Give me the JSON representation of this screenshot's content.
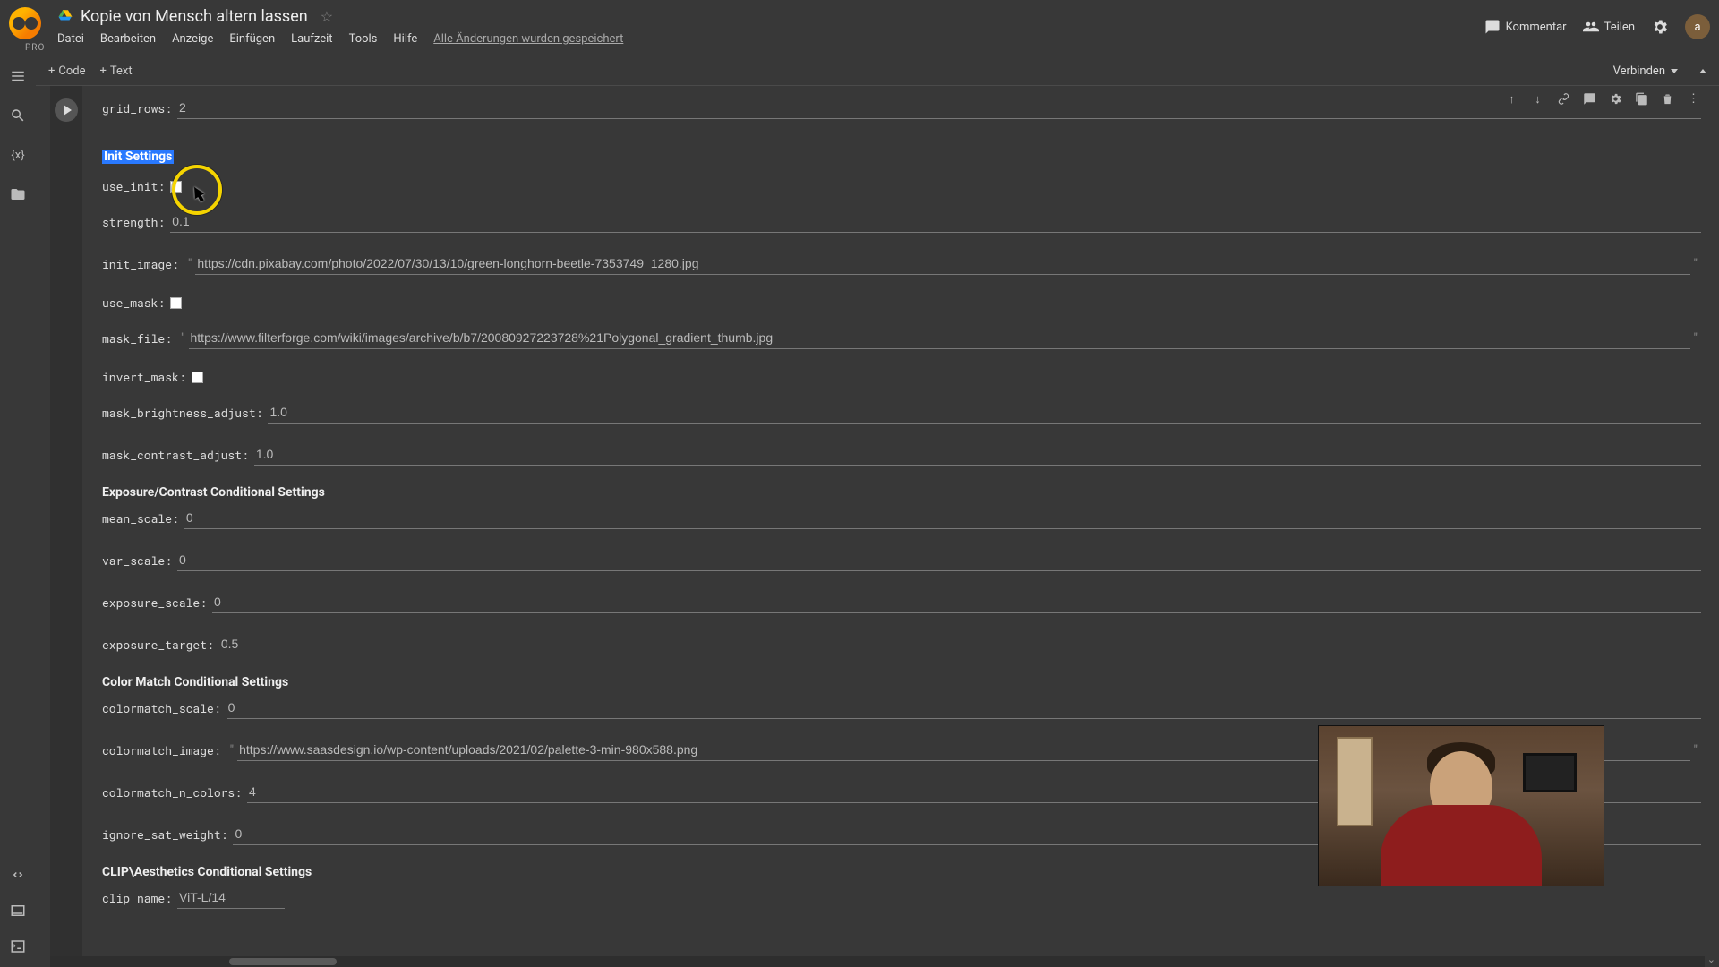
{
  "header": {
    "title": "Kopie von Mensch altern lassen",
    "pro_badge": "PRO",
    "menus": [
      "Datei",
      "Bearbeiten",
      "Anzeige",
      "Einfügen",
      "Laufzeit",
      "Tools",
      "Hilfe"
    ],
    "changes_saved": "Alle Änderungen wurden gespeichert",
    "comment": "Kommentar",
    "share": "Teilen",
    "avatar_initial": "a"
  },
  "toolbar": {
    "code": "Code",
    "text": "Text",
    "connect": "Verbinden"
  },
  "form": {
    "grid_rows": {
      "label": "grid_rows:",
      "value": "2"
    },
    "section_init": "Init Settings",
    "use_init": {
      "label": "use_init:"
    },
    "strength": {
      "label": "strength:",
      "value": "0.1"
    },
    "init_image": {
      "label": "init_image:",
      "value": "https://cdn.pixabay.com/photo/2022/07/30/13/10/green-longhorn-beetle-7353749_1280.jpg"
    },
    "use_mask": {
      "label": "use_mask:"
    },
    "mask_file": {
      "label": "mask_file:",
      "value": "https://www.filterforge.com/wiki/images/archive/b/b7/20080927223728%21Polygonal_gradient_thumb.jpg"
    },
    "invert_mask": {
      "label": "invert_mask:"
    },
    "mask_brightness_adjust": {
      "label": "mask_brightness_adjust:",
      "value": "1.0"
    },
    "mask_contrast_adjust": {
      "label": "mask_contrast_adjust:",
      "value": "1.0"
    },
    "section_exposure": "Exposure/Contrast Conditional Settings",
    "mean_scale": {
      "label": "mean_scale:",
      "value": "0"
    },
    "var_scale": {
      "label": "var_scale:",
      "value": "0"
    },
    "exposure_scale": {
      "label": "exposure_scale:",
      "value": "0"
    },
    "exposure_target": {
      "label": "exposure_target:",
      "value": "0.5"
    },
    "section_color": "Color Match Conditional Settings",
    "colormatch_scale": {
      "label": "colormatch_scale:",
      "value": "0"
    },
    "colormatch_image": {
      "label": "colormatch_image:",
      "value": "https://www.saasdesign.io/wp-content/uploads/2021/02/palette-3-min-980x588.png"
    },
    "colormatch_n_colors": {
      "label": "colormatch_n_colors:",
      "value": "4"
    },
    "ignore_sat_weight": {
      "label": "ignore_sat_weight:",
      "value": "0"
    },
    "section_clip": "CLIP\\Aesthetics Conditional Settings",
    "clip_name": {
      "label": "clip_name:",
      "value": "ViT-L/14"
    }
  }
}
